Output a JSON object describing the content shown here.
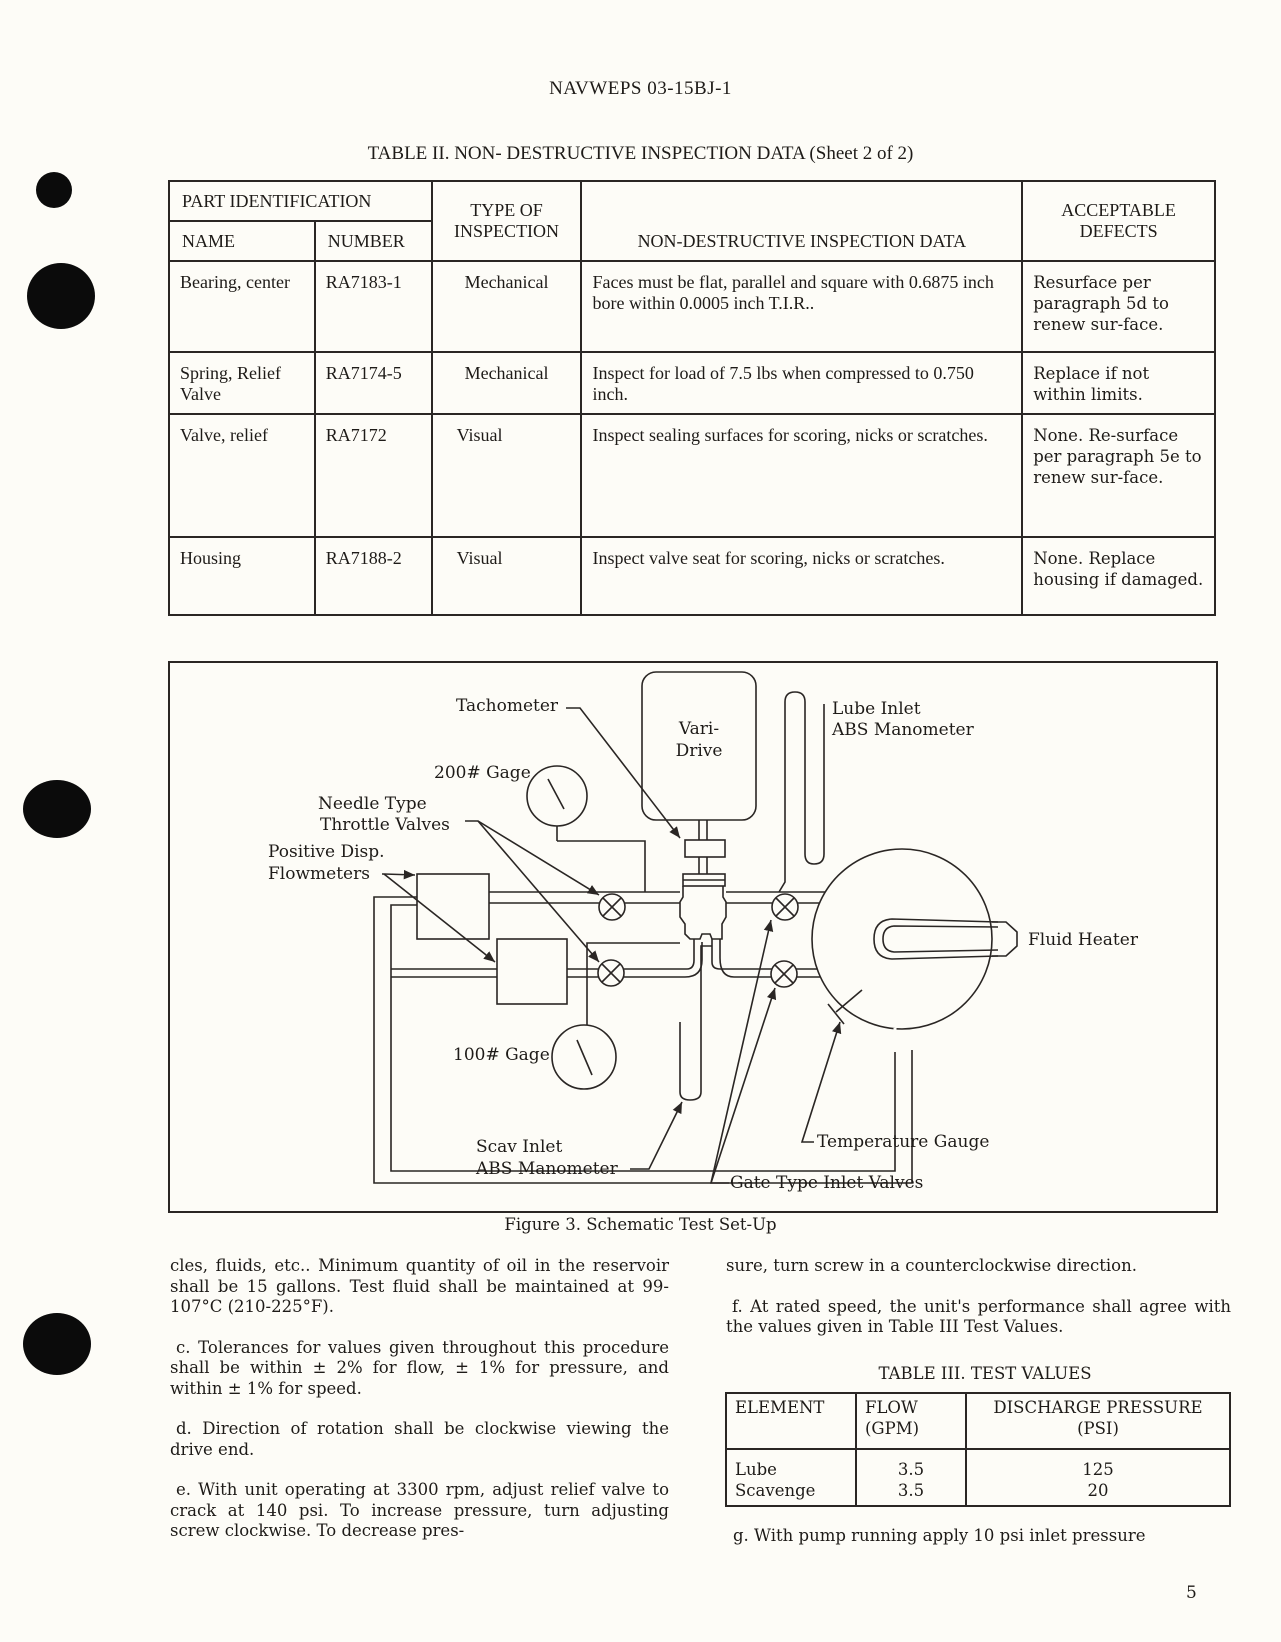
{
  "header": {
    "doc_id": "NAVWEPS 03-15BJ-1"
  },
  "table2": {
    "title": "TABLE II.  NON- DESTRUCTIVE INSPECTION DATA  (Sheet 2 of 2)",
    "headers": {
      "part_identification": "PART IDENTIFICATION",
      "name": "NAME",
      "number": "NUMBER",
      "type_of_inspection": "TYPE OF INSPECTION",
      "inspection_data": "NON-DESTRUCTIVE INSPECTION DATA",
      "acceptable_defects": "ACCEPTABLE DEFECTS"
    },
    "rows": [
      {
        "name": "Bearing, center",
        "number": "RA7183-1",
        "type": "Mechanical",
        "data": "Faces must be flat, parallel and square with 0.6875 inch bore within 0.0005 inch T.I.R..",
        "defects": "Resurface per paragraph 5d to renew sur-face."
      },
      {
        "name": "Spring, Relief Valve",
        "number": "RA7174-5",
        "type": "Mechanical",
        "data": "Inspect for load of 7.5 lbs when compressed to 0.750 inch.",
        "defects": "Replace if not within limits."
      },
      {
        "name": "Valve, relief",
        "number": "RA7172",
        "type": "Visual",
        "data": "Inspect sealing surfaces for scoring, nicks or scratches.",
        "defects": "None.  Re-surface per paragraph 5e to renew sur-face."
      },
      {
        "name": "Housing",
        "number": "RA7188-2",
        "type": "Visual",
        "data": "Inspect valve seat for scoring, nicks or scratches.",
        "defects": "None. Replace housing if damaged."
      }
    ]
  },
  "figure3": {
    "caption": "Figure 3.  Schematic Test Set-Up",
    "labels": {
      "tachometer": "Tachometer",
      "vari_drive_1": "Vari-",
      "vari_drive_2": "Drive",
      "lube_inlet_1": "Lube Inlet",
      "lube_inlet_2": "ABS Manometer",
      "gage_200": "200# Gage",
      "needle_1": "Needle Type",
      "needle_2": "Throttle Valves",
      "flowmeters_1": "Positive Disp.",
      "flowmeters_2": "Flowmeters",
      "fluid_heater": "Fluid Heater",
      "gage_100": "100# Gage",
      "scav_1": "Scav Inlet",
      "scav_2": "ABS Manometer",
      "temp_gauge": "Temperature Gauge",
      "gate_valves": "Gate Type Inlet Valves"
    }
  },
  "left_column": {
    "p1": "cles, fluids, etc..  Minimum quantity of oil in the reservoir shall be 15 gallons.  Test fluid shall be maintained at 99-107°C (210-225°F).",
    "p_c": "c.  Tolerances for values given throughout this procedure shall be within ± 2% for flow, ± 1% for pressure, and within ± 1% for speed.",
    "p_d": "d.  Direction of rotation shall be clockwise viewing the drive end.",
    "p_e": "e.  With unit operating at 3300 rpm, adjust relief valve to crack at 140 psi.  To increase pressure, turn adjusting screw clockwise.  To decrease pres-"
  },
  "right_column": {
    "p1": "sure, turn screw in a counterclockwise direction.",
    "p_f": "f.  At rated speed, the unit's performance shall agree with the values given in Table III Test Values.",
    "p_g": "g.  With pump running apply 10 psi inlet pressure"
  },
  "table3": {
    "title": "TABLE III.  TEST VALUES",
    "headers": {
      "element": "ELEMENT",
      "flow": "FLOW (GPM)",
      "pressure": "DISCHARGE PRESSURE (PSI)"
    },
    "rows": [
      {
        "element": "Lube",
        "flow": "3.5",
        "pressure": "125"
      },
      {
        "element": "Scavenge",
        "flow": "3.5",
        "pressure": "20"
      }
    ]
  },
  "footer": {
    "page_number": "5"
  }
}
